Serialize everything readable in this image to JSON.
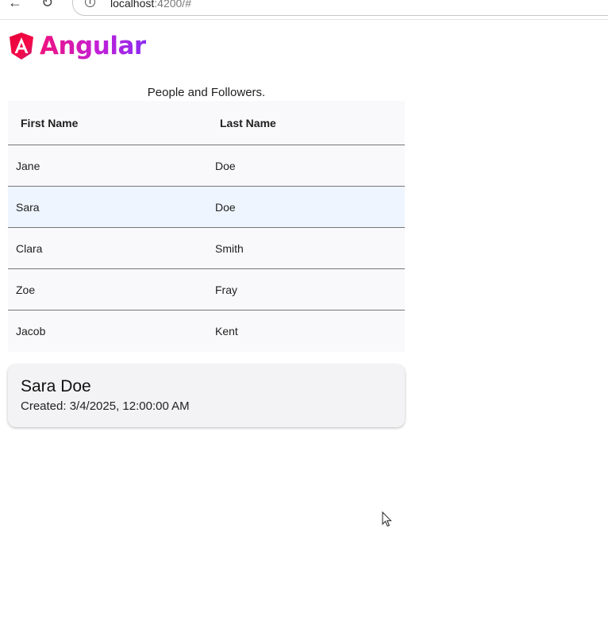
{
  "browser": {
    "url_host": "localhost",
    "url_path": ":4200/#"
  },
  "logo": {
    "text": "Angular"
  },
  "table": {
    "caption": "People and Followers.",
    "columns": [
      "First Name",
      "Last Name"
    ],
    "rows": [
      {
        "first": "Jane",
        "last": "Doe"
      },
      {
        "first": "Sara",
        "last": "Doe"
      },
      {
        "first": "Clara",
        "last": "Smith"
      },
      {
        "first": "Zoe",
        "last": "Fray"
      },
      {
        "first": "Jacob",
        "last": "Kent"
      }
    ],
    "selected_index": 1
  },
  "detail": {
    "name": "Sara Doe",
    "created": "Created: 3/4/2025, 12:00:00 AM"
  }
}
